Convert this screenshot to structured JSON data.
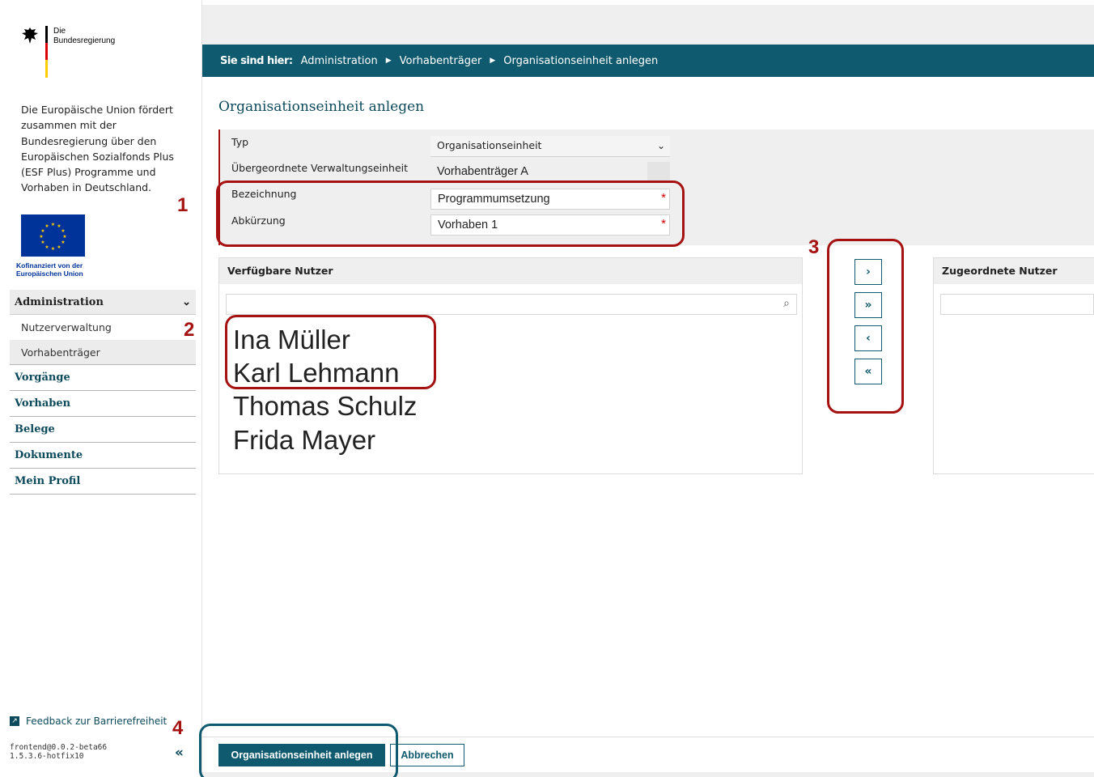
{
  "logo": {
    "line1": "Die",
    "line2": "Bundesregierung"
  },
  "sidebar": {
    "eu_text": "Die Europäische Union fördert zusammen mit der Bundesregierung über den Europäischen Sozialfonds Plus (ESF Plus) Programme und Vorhaben in Deutschland.",
    "cofund_line1": "Kofinanziert von der",
    "cofund_line2": "Europäischen Union",
    "nav_head": "Administration",
    "nav_sub": [
      "Nutzerverwaltung",
      "Vorhabenträger"
    ],
    "nav_items": [
      "Vorgänge",
      "Vorhaben",
      "Belege",
      "Dokumente",
      "Mein Profil"
    ],
    "feedback": "Feedback zur Barrierefreiheit",
    "version_line1": "frontend@0.0.2-beta66",
    "version_line2": "1.5.3.6-hotfix10"
  },
  "breadcrumb": {
    "lead": "Sie sind hier:",
    "items": [
      "Administration",
      "Vorhabenträger",
      "Organisationseinheit anlegen"
    ]
  },
  "page_title": "Organisationseinheit anlegen",
  "form": {
    "type_label": "Typ",
    "type_value": "Organisationseinheit",
    "parent_label": "Übergeordnete Verwaltungseinheit",
    "parent_value": "Vorhabenträger A",
    "name_label": "Bezeichnung",
    "name_value": "Programmumsetzung",
    "abbr_label": "Abkürzung",
    "abbr_value": "Vorhaben 1",
    "required_mark": "*"
  },
  "available_users": {
    "title": "Verfügbare Nutzer",
    "users": [
      "Ina Müller",
      "Karl Lehmann",
      "Thomas Schulz",
      "Frida Mayer"
    ]
  },
  "assigned_users": {
    "title": "Zugeordnete Nutzer"
  },
  "transfer_buttons": {
    "add": "›",
    "add_all": "»",
    "remove": "‹",
    "remove_all": "«"
  },
  "actions": {
    "create": "Organisationseinheit anlegen",
    "cancel": "Abbrechen"
  },
  "annotations": [
    "1",
    "2",
    "3",
    "4"
  ],
  "colors": {
    "accent": "#0f5a6e",
    "highlight": "#a51212"
  }
}
